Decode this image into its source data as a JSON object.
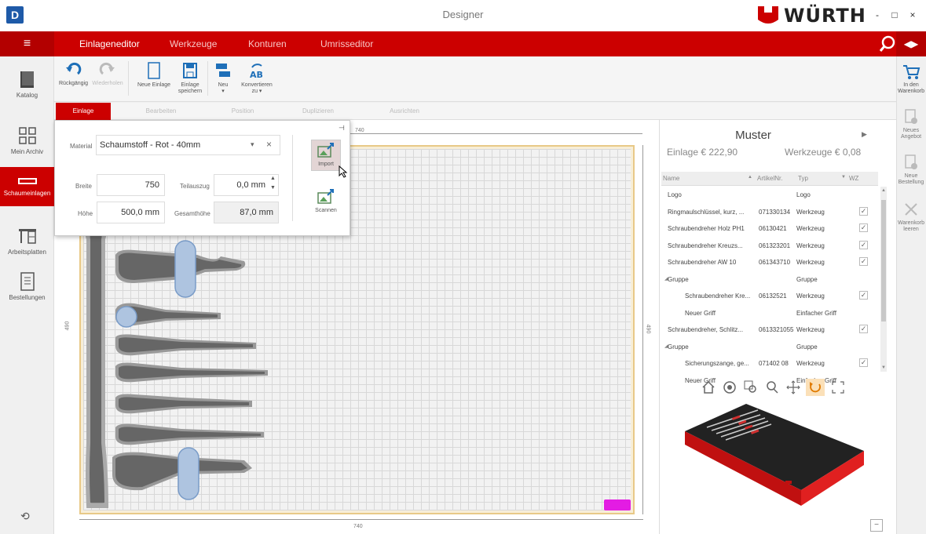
{
  "app": {
    "icon_letter": "D",
    "title": "Designer",
    "brand": "WÜRTH"
  },
  "window": {
    "minimize": "-",
    "maximize": "□",
    "close": "×"
  },
  "nav": {
    "menu_icon": "menu-icon",
    "tabs": [
      {
        "label": "Einlageneditor",
        "active": true
      },
      {
        "label": "Werkzeuge",
        "active": false
      },
      {
        "label": "Konturen",
        "active": false
      },
      {
        "label": "Umrisseditor",
        "active": false
      }
    ],
    "search_icon": "search-icon",
    "collapse_icon": "double-arrow-icon"
  },
  "left_sidebar": [
    {
      "label": "Katalog",
      "icon": "book-icon",
      "active": false
    },
    {
      "label": "Mein Archiv",
      "icon": "grid-icon",
      "active": false
    },
    {
      "label": "Schaumeinlagen",
      "icon": "foam-insert-icon",
      "active": true
    },
    {
      "label": "Arbeitsplatten",
      "icon": "workbench-icon",
      "active": false
    },
    {
      "label": "Bestellungen",
      "icon": "document-icon",
      "active": false
    }
  ],
  "left_footer_icon": "sync-icon",
  "right_sidebar": [
    {
      "label": "In den Warenkorb",
      "icon": "cart-add-icon",
      "enabled": true
    },
    {
      "label": "Neues Angebot",
      "icon": "offer-icon",
      "enabled": false
    },
    {
      "label": "Neue Bestellung",
      "icon": "order-icon",
      "enabled": false
    },
    {
      "label": "Warenkorb leeren",
      "icon": "clear-cart-icon",
      "enabled": false
    }
  ],
  "toolbar": {
    "undo": "Rückgängig",
    "redo": "Wiederholen",
    "new_insert": "Neue Einlage",
    "save_insert_1": "Einlage",
    "save_insert_2": "speichern",
    "new": "Neu",
    "convert_1": "Konvertieren",
    "convert_2": "zu"
  },
  "subtabs": [
    {
      "label": "Einlage",
      "active": true
    },
    {
      "label": "Bearbeiten",
      "active": false
    },
    {
      "label": "Position",
      "active": false
    },
    {
      "label": "Duplizieren",
      "active": false
    },
    {
      "label": "Ausrichten",
      "active": false
    }
  ],
  "properties": {
    "material_label": "Material",
    "material_value": "Schaumstoff - Rot - 40mm",
    "width_label": "Breite",
    "width_value": "750",
    "pullout_label": "Teilauszug",
    "pullout_value": "0,0 mm",
    "height_label": "Höhe",
    "height_value": "500,0 mm",
    "total_height_label": "Gesamthöhe",
    "total_height_value": "87,0 mm",
    "import_label": "Import",
    "scan_label": "Scannen",
    "pin_icon": "pin-icon"
  },
  "canvas": {
    "dim_top": "740",
    "dim_bottom": "740",
    "dim_left": "490",
    "dim_right": "490",
    "colors": {
      "board_border": "#e8c987",
      "foam_dark": "#666666",
      "selection": "#aec4e0",
      "marker": "#e31ce3"
    }
  },
  "summary": {
    "title": "Muster",
    "insert_price": "Einlage € 222,90",
    "tools_price": "Werkzeuge € 0,08"
  },
  "table": {
    "headers": {
      "name": "Name",
      "article": "ArtikelNr.",
      "type": "Typ",
      "wz": "WZ"
    },
    "rows": [
      {
        "name": "Logo",
        "article": "",
        "type": "Logo",
        "checked": false,
        "indent": 0,
        "group": false
      },
      {
        "name": "Ringmaulschlüssel, kurz, ...",
        "article": "071330134",
        "type": "Werkzeug",
        "checked": true,
        "indent": 0,
        "group": false
      },
      {
        "name": "Schraubendreher Holz PH1",
        "article": "06130421",
        "type": "Werkzeug",
        "checked": true,
        "indent": 0,
        "group": false
      },
      {
        "name": "Schraubendreher Kreuzs...",
        "article": "061323201",
        "type": "Werkzeug",
        "checked": true,
        "indent": 0,
        "group": false
      },
      {
        "name": "Schraubendreher AW 10",
        "article": "061343710",
        "type": "Werkzeug",
        "checked": true,
        "indent": 0,
        "group": false
      },
      {
        "name": "Gruppe",
        "article": "",
        "type": "Gruppe",
        "checked": false,
        "indent": 0,
        "group": true
      },
      {
        "name": "Schraubendreher Kre...",
        "article": "06132521",
        "type": "Werkzeug",
        "checked": true,
        "indent": 1,
        "group": false
      },
      {
        "name": "Neuer Griff",
        "article": "",
        "type": "Einfacher Griff",
        "checked": false,
        "indent": 1,
        "group": false
      },
      {
        "name": "Schraubendreher, Schlitz...",
        "article": "0613321055",
        "type": "Werkzeug",
        "checked": true,
        "indent": 0,
        "group": false
      },
      {
        "name": "Gruppe",
        "article": "",
        "type": "Gruppe",
        "checked": false,
        "indent": 0,
        "group": true
      },
      {
        "name": "Sicherungszange, ge...",
        "article": "071402 08",
        "type": "Werkzeug",
        "checked": true,
        "indent": 1,
        "group": false
      },
      {
        "name": "Neuer Griff",
        "article": "",
        "type": "Einfacher Griff",
        "checked": false,
        "indent": 1,
        "group": false
      }
    ]
  },
  "viewer_tools": [
    "home-icon",
    "orbit-icon",
    "zoom-window-icon",
    "zoom-icon",
    "pan-icon",
    "rotate-icon",
    "fit-icon"
  ]
}
